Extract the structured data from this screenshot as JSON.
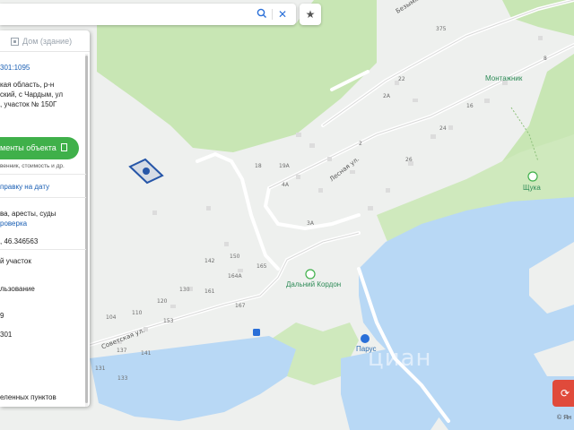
{
  "search": {
    "search_icon": "search-icon",
    "clear_icon": "close-icon",
    "favorite_icon": "star-icon"
  },
  "panel": {
    "title": "Дом (здание)",
    "cadastral_number": "301:1095",
    "address_lines": [
      "кая область, р-н",
      "ский, с Чардым, ул",
      ", участок № 150Г"
    ],
    "docs_button": "менты объекта",
    "docs_hint": "венник, стоимость и др.",
    "date_link": "правку на дату",
    "rights_text": "ва, аресты, суды",
    "check_link": "роверка",
    "coords": ", 46.346563",
    "items": [
      "й участок",
      "льзование",
      "9",
      "301",
      "",
      "еленных пунктов"
    ]
  },
  "map": {
    "streets": [
      {
        "name": "Безымянная ул."
      },
      {
        "name": "Лесная ул."
      },
      {
        "name": "Советская ул."
      }
    ],
    "house_numbers": [
      "375",
      "8",
      "22",
      "2А",
      "16",
      "2",
      "24",
      "26",
      "18",
      "19А",
      "4А",
      "3А",
      "142",
      "150",
      "165",
      "164А",
      "120",
      "130",
      "161",
      "167",
      "153",
      "104",
      "110",
      "137",
      "131",
      "133",
      "141"
    ],
    "pois": [
      {
        "name": "Монтажник"
      },
      {
        "name": "Щука"
      },
      {
        "name": "Дальний Кордон"
      },
      {
        "name": "Парус"
      }
    ],
    "watermark": "циан",
    "copyright": "© Ян"
  },
  "colors": {
    "water": "#b8d8f5",
    "forest": "#c8e6b4",
    "land": "#eef0ee",
    "accent_green": "#3fb04a",
    "accent_blue": "#1a5fb4",
    "marker": "#2656a8"
  }
}
